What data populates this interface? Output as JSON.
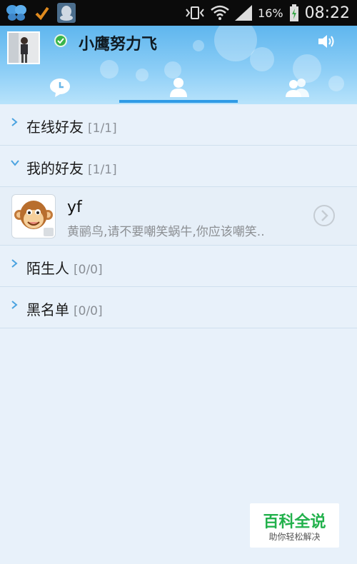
{
  "status_bar": {
    "battery_percent": "16%",
    "time": "08:22",
    "icons": [
      "butterfly-app-icon",
      "check-icon",
      "qq-penguin-icon",
      "vibrate-icon",
      "wifi-icon",
      "signal-icon",
      "battery-charging-icon"
    ]
  },
  "header": {
    "nickname": "小鹰努力飞",
    "online_status": "online",
    "tabs": [
      {
        "name": "recent",
        "icon": "clock-chat-icon",
        "selected": false
      },
      {
        "name": "contacts",
        "icon": "person-icon",
        "selected": true
      },
      {
        "name": "groups",
        "icon": "people-icon",
        "selected": false
      }
    ],
    "colors": {
      "accent": "#2f9be6",
      "online": "#39b54a"
    }
  },
  "groups": [
    {
      "name": "在线好友",
      "count": "[1/1]",
      "expanded": false
    },
    {
      "name": "我的好友",
      "count": "[1/1]",
      "expanded": true
    },
    {
      "name": "陌生人",
      "count": "[0/0]",
      "expanded": false
    },
    {
      "name": "黑名单",
      "count": "[0/0]",
      "expanded": false
    }
  ],
  "friend": {
    "name": "yf",
    "signature": "黄鹂鸟,请不要嘲笑蜗牛,你应该嘲笑.."
  },
  "watermark": {
    "title": "百科全说",
    "subtitle": "助你轻松解决"
  }
}
